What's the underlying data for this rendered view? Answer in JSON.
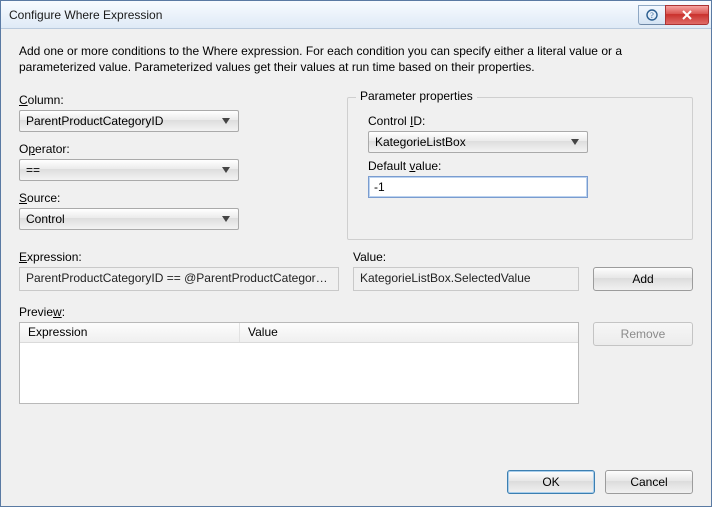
{
  "title": "Configure Where Expression",
  "intro": "Add one or more conditions to the Where expression. For each condition you can specify either a literal value or a parameterized value. Parameterized values get their values at run time based on their properties.",
  "left": {
    "column_label_pre": "",
    "column_label_u": "C",
    "column_label_post": "olumn:",
    "column_value": "ParentProductCategoryID",
    "operator_label_pre": "O",
    "operator_label_u": "p",
    "operator_label_post": "erator:",
    "operator_value": "==",
    "source_label_pre": "",
    "source_label_u": "S",
    "source_label_post": "ource:",
    "source_value": "Control"
  },
  "params": {
    "legend": "Parameter properties",
    "control_id_label_pre": "Control ",
    "control_id_label_u": "I",
    "control_id_label_post": "D:",
    "control_id_value": "KategorieListBox",
    "default_label_pre": "Default ",
    "default_label_u": "v",
    "default_label_post": "alue:",
    "default_value": "-1"
  },
  "expr": {
    "expression_label_pre": "",
    "expression_label_u": "E",
    "expression_label_post": "xpression:",
    "expression_value": "ParentProductCategoryID == @ParentProductCategoryID",
    "value_label": "Value:",
    "value_value": "KategorieListBox.SelectedValue",
    "add_label_u": "A",
    "add_label_post": "dd"
  },
  "preview": {
    "label_pre": "Previe",
    "label_u": "w",
    "label_post": ":",
    "col_expression": "Expression",
    "col_value": "Value",
    "remove_label_u": "R",
    "remove_label_post": "emove"
  },
  "footer": {
    "ok": "OK",
    "cancel": "Cancel"
  }
}
